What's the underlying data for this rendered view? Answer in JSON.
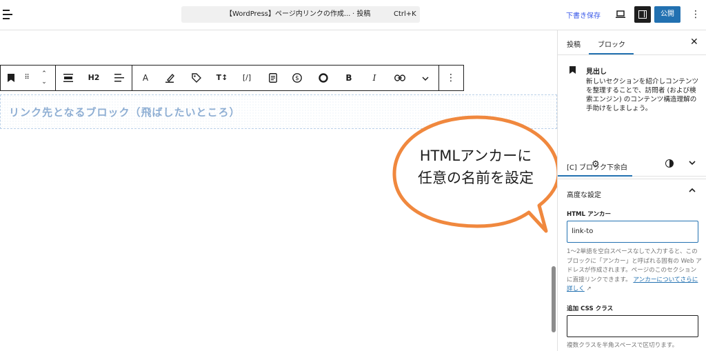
{
  "topbar": {
    "command_title": "【WordPress】ページ内リンクの作成...",
    "command_type": "· 投稿",
    "shortcut": "Ctrl+K",
    "draft_label": "下書き保存",
    "publish_label": "公開"
  },
  "toolbar": {
    "heading_level": "H2",
    "text_color_glyph": "A",
    "ruby_glyph": "T↕",
    "code_glyph": "[/]",
    "bold_glyph": "B",
    "italic_glyph": "I"
  },
  "canvas": {
    "heading_text": "リンク先となるブロック（飛ばしたいところ）"
  },
  "callout": {
    "line1": "HTMLアンカーに",
    "line2": "任意の名前を設定"
  },
  "sidebar": {
    "tab_post": "投稿",
    "tab_block": "ブロック",
    "block_title": "見出し",
    "block_desc": "新しいセクションを紹介しコンテンツを整理することで、訪問者 (および検索エンジン) のコンテンツ構造理解の手助けをしましょう。",
    "panel_margin_title": "[C] ブロック下余白",
    "panel_advanced_title": "高度な設定",
    "anchor_label": "HTML アンカー",
    "anchor_value": "link-to",
    "anchor_help": "1〜2単語を空白スペースなしで入力すると、このブロックに「アンカー」と呼ばれる固有の Web アドレスが作成されます。ページのこのセクションに直接リンクできます。",
    "anchor_help_link": "アンカーについてさらに詳しく",
    "css_label": "追加 CSS クラス",
    "css_value": "",
    "css_help": "複数クラスを半角スペースで区切ります。"
  },
  "colors": {
    "accent": "#2271b1",
    "callout_border": "#f0883e",
    "heading_text": "#8eaed3"
  }
}
